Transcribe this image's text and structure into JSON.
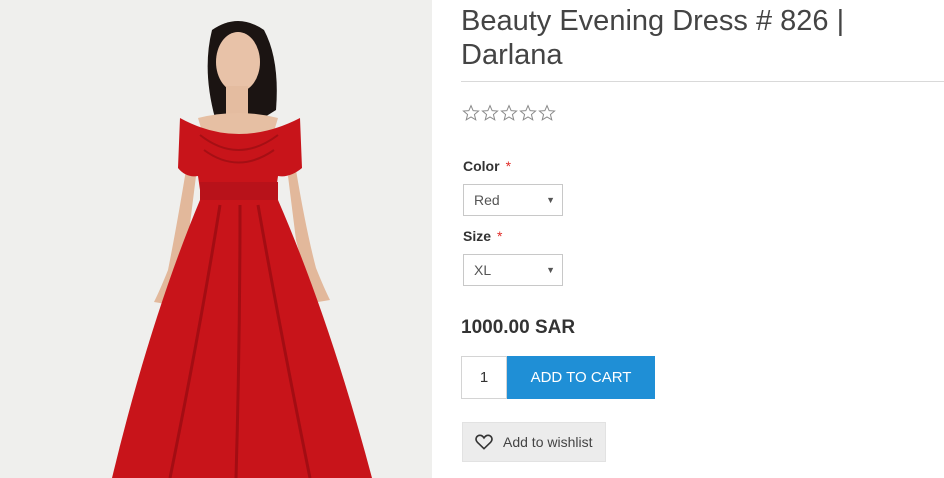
{
  "product": {
    "title": "Beauty Evening Dress # 826 | Darlana",
    "rating_stars": 0,
    "rating_max": 5,
    "price": "1000.00 SAR",
    "image_icon": "product-photo-red-dress"
  },
  "options": {
    "color": {
      "label": "Color",
      "required_mark": "*",
      "selected": "Red"
    },
    "size": {
      "label": "Size",
      "required_mark": "*",
      "selected": "XL"
    }
  },
  "cart": {
    "quantity": "1",
    "add_to_cart_label": "ADD TO CART",
    "button_color": "#1f8fd6"
  },
  "wishlist": {
    "label": "Add to wishlist",
    "icon": "heart-icon"
  },
  "colors": {
    "required": "#e02b27",
    "dress": "#c8141a"
  }
}
